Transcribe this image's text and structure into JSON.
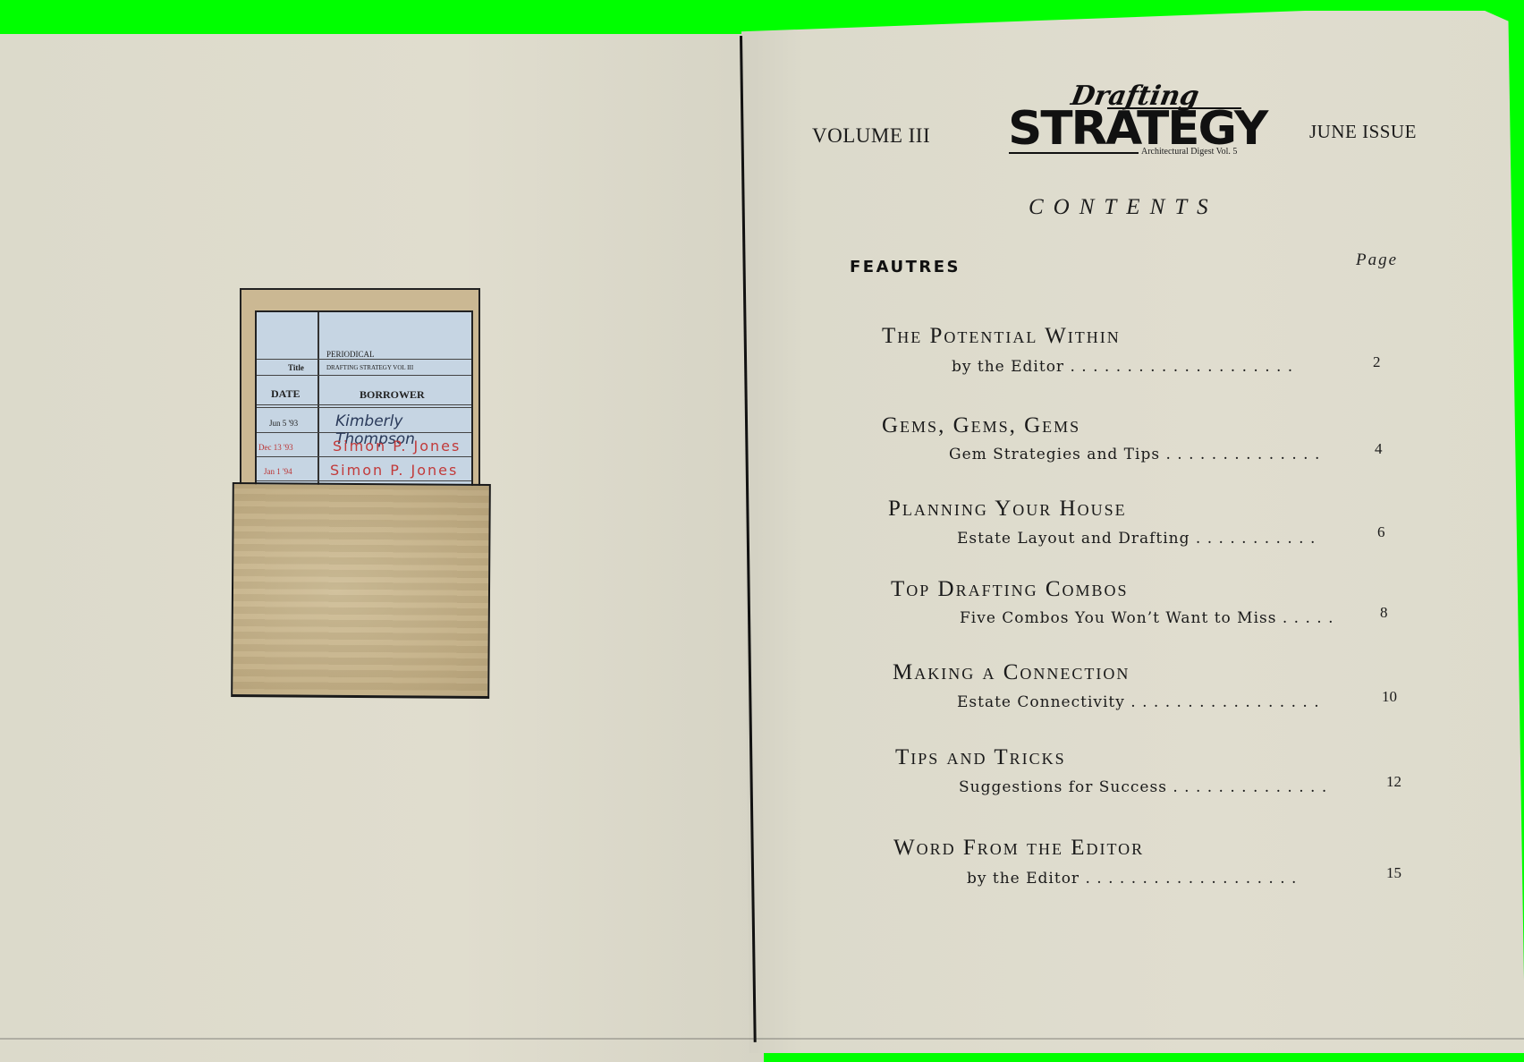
{
  "header": {
    "volume": "VOLUME III",
    "issue": "JUNE ISSUE",
    "logo": {
      "script": "Drafting",
      "main": "STRATEGY",
      "sub": "Architectural Digest Vol. 5"
    }
  },
  "contents": {
    "title": "CONTENTS",
    "section_label": "FEAUTRES",
    "page_label": "Page",
    "entries": [
      {
        "title": "The Potential Within",
        "subtitle": "by the Editor . . . . . . . . . . . . . . . . . . . .",
        "page": "2"
      },
      {
        "title": "Gems, Gems, Gems",
        "subtitle": "Gem Strategies and Tips  . . . . . . . . . . . . . .",
        "page": "4"
      },
      {
        "title": "Planning Your House",
        "subtitle": "Estate Layout and Drafting  . . . . . . . . . . .",
        "page": "6"
      },
      {
        "title": "Top Drafting Combos",
        "subtitle": "Five Combos You Won’t Want to Miss  . . . . .",
        "page": "8"
      },
      {
        "title": "Making a Connection",
        "subtitle": "Estate Connectivity . . . . . . . . . . . . . . . . .",
        "page": "10"
      },
      {
        "title": "Tips and Tricks",
        "subtitle": "Suggestions for Success  . . . . . . . . . . . . . .",
        "page": "12"
      },
      {
        "title": "Word From the Editor",
        "subtitle": "by the Editor  . . . . . . . . . . . . . . . . . . .",
        "page": "15"
      }
    ]
  },
  "library_card": {
    "type_label": "PERIODICAL",
    "title_label": "Title",
    "title_value": "DRAFTING STRATEGY VOL III",
    "date_header": "DATE",
    "borrower_header": "BORROWER",
    "rows": [
      {
        "date": "Jun 5 '93",
        "borrower": "Kimberly  Thompson",
        "color": "#2a3a5a"
      },
      {
        "date": "Dec 13 '93",
        "borrower": "Simon P. Jones",
        "color": "#c23a3a"
      },
      {
        "date": "Jan 1 '94",
        "borrower": "Simon P. Jones",
        "color": "#c23a3a"
      }
    ]
  }
}
